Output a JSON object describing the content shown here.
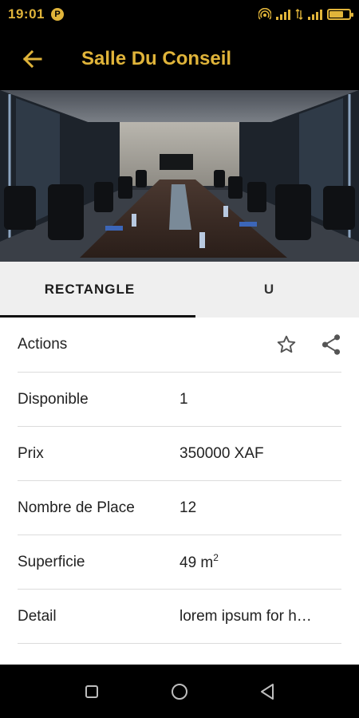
{
  "status_bar": {
    "time": "19:01",
    "p_badge": "P"
  },
  "app_bar": {
    "title": "Salle Du Conseil"
  },
  "tabs": [
    {
      "label": "RECTANGLE",
      "selected": true
    },
    {
      "label": "U",
      "selected": false
    }
  ],
  "details": {
    "actions_label": "Actions",
    "rows": [
      {
        "label": "Disponible",
        "value": "1"
      },
      {
        "label": "Prix",
        "value": "350000 XAF"
      },
      {
        "label": "Nombre de Place",
        "value": "12"
      },
      {
        "label": "Superficie",
        "value": "49 m",
        "unit_sup": "2"
      },
      {
        "label": "Detail",
        "value": "lorem ipsum for h…"
      }
    ]
  },
  "icons": {
    "back": "arrow-left-icon",
    "favorite": "star-outline-icon",
    "share": "share-icon",
    "nav": [
      "square-icon",
      "circle-icon",
      "triangle-back-icon"
    ]
  },
  "colors": {
    "accent": "#e0b43a",
    "bar_bg": "#000000",
    "tab_bg": "#efefef"
  }
}
